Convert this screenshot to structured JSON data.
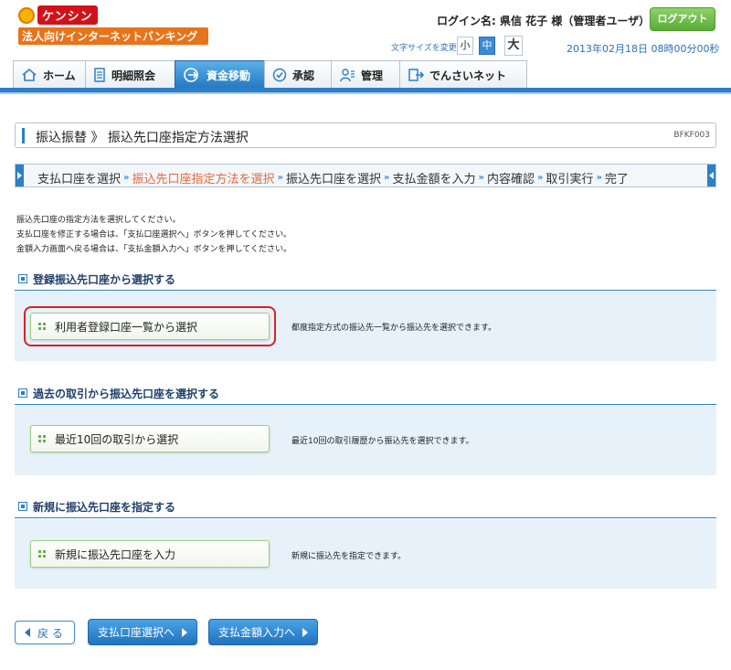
{
  "brand": {
    "name": "ケンシン",
    "subtitle": "法人向けインターネットバンキング"
  },
  "header": {
    "login_name": "ログイン名: 県信 花子 様（管理者ユーザ）",
    "logout_label": "ログアウト",
    "font_size_label": "文字サイズを変更",
    "font_sizes": [
      "小",
      "中",
      "大"
    ],
    "font_size_selected": "中",
    "datetime": "2013年02月18日 08時00分00秒"
  },
  "nav": {
    "tabs": [
      {
        "label": "ホーム",
        "icon": "home-icon"
      },
      {
        "label": "明細照会",
        "icon": "document-icon"
      },
      {
        "label": "資金移動",
        "icon": "transfer-icon",
        "active": true
      },
      {
        "label": "承認",
        "icon": "check-icon"
      },
      {
        "label": "管理",
        "icon": "user-icon"
      },
      {
        "label": "でんさいネット",
        "icon": "densai-icon"
      }
    ]
  },
  "page": {
    "title": "振込振替 》 振込先口座指定方法選択",
    "screen_id": "BFKF003"
  },
  "steps": {
    "items": [
      "支払口座を選択",
      "振込先口座指定方法を選択",
      "振込先口座を選択",
      "支払金額を入力",
      "内容確認",
      "取引実行",
      "完了"
    ],
    "current_index": 1,
    "separator": "»"
  },
  "instructions": [
    "振込先口座の指定方法を選択してください。",
    "支払口座を修正する場合は、「支払口座選択へ」ボタンを押してください。",
    "金額入力画面へ戻る場合は、「支払金額入力へ」ボタンを押してください。"
  ],
  "sections": [
    {
      "heading": "登録振込先口座から選択する",
      "button_label": "利用者登録口座一覧から選択",
      "description": "都度指定方式の振込先一覧から振込先を選択できます。",
      "highlighted": true
    },
    {
      "heading": "過去の取引から振込先口座を選択する",
      "button_label": "最近10回の取引から選択",
      "description": "最近10回の取引履歴から振込先を選択できます。",
      "highlighted": false
    },
    {
      "heading": "新規に振込先口座を指定する",
      "button_label": "新規に振込先口座を入力",
      "description": "新規に振込先を指定できます。",
      "highlighted": false
    }
  ],
  "footer": {
    "back_label": "戻 る",
    "payment_account_label": "支払口座選択へ",
    "payment_amount_label": "支払金額入力へ"
  },
  "colors": {
    "primary_blue": "#2d7fc7",
    "current_step": "#e06b3a",
    "logout_green": "#58ad35",
    "highlight_red": "#e02020",
    "section_bg": "#e6f1fa"
  }
}
